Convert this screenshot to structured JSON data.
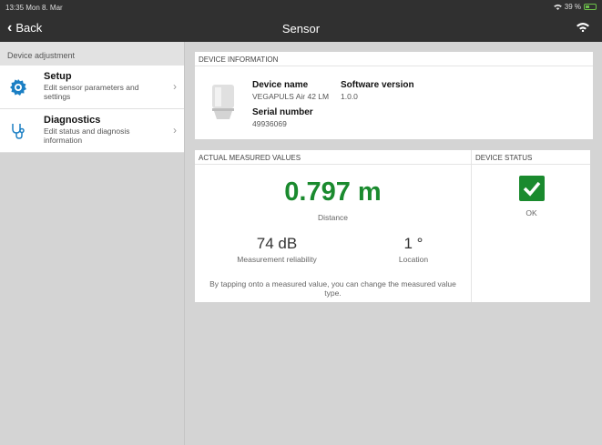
{
  "status_bar": {
    "time": "13:35  Mon 8. Mar",
    "battery_text": "39 %"
  },
  "nav": {
    "back_label": "Back",
    "title": "Sensor"
  },
  "sidebar": {
    "header": "Device adjustment",
    "items": [
      {
        "title": "Setup",
        "subtitle": "Edit sensor parameters and settings",
        "icon": "gear-icon"
      },
      {
        "title": "Diagnostics",
        "subtitle": "Edit status and diagnosis information",
        "icon": "stethoscope-icon"
      }
    ]
  },
  "device_info": {
    "header": "DEVICE INFORMATION",
    "device_name_label": "Device name",
    "device_name": "VEGAPULS Air 42 LM",
    "software_version_label": "Software version",
    "software_version": "1.0.0",
    "serial_number_label": "Serial number",
    "serial_number": "49936069"
  },
  "measured": {
    "header": "ACTUAL MEASURED VALUES",
    "main_value": "0.797 m",
    "main_caption": "Distance",
    "reliability_value": "74 dB",
    "reliability_caption": "Measurement reliability",
    "location_value": "1 °",
    "location_caption": "Location",
    "note": "By tapping onto a measured value, you can change the measured value type."
  },
  "device_status": {
    "header": "DEVICE STATUS",
    "status_text": "OK"
  },
  "colors": {
    "accent_green": "#1a8a2e",
    "bar_dark": "#303030",
    "icon_blue": "#1b7fc4"
  }
}
